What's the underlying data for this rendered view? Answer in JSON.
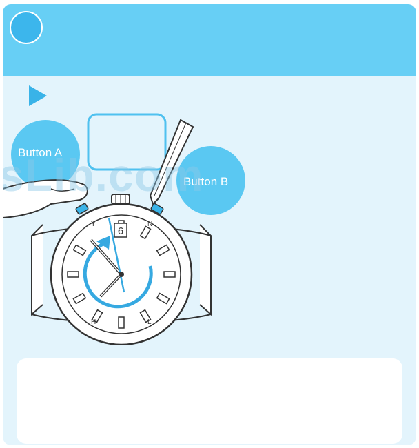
{
  "illustration": {
    "button_a_label": "Button A",
    "button_b_label": "Button B",
    "date_window": "6",
    "compass": {
      "north": "N",
      "south": "H",
      "west": "Y",
      "east": "L"
    }
  },
  "watermark": {
    "text": "sLib.com"
  },
  "colors": {
    "header": "#67cff5",
    "panel": "#e3f4fc",
    "accent": "#3cb6ec",
    "arrow": "#39b3e8",
    "button_bubble": "#5ac8f2",
    "hand_blue": "#36a9e1"
  }
}
